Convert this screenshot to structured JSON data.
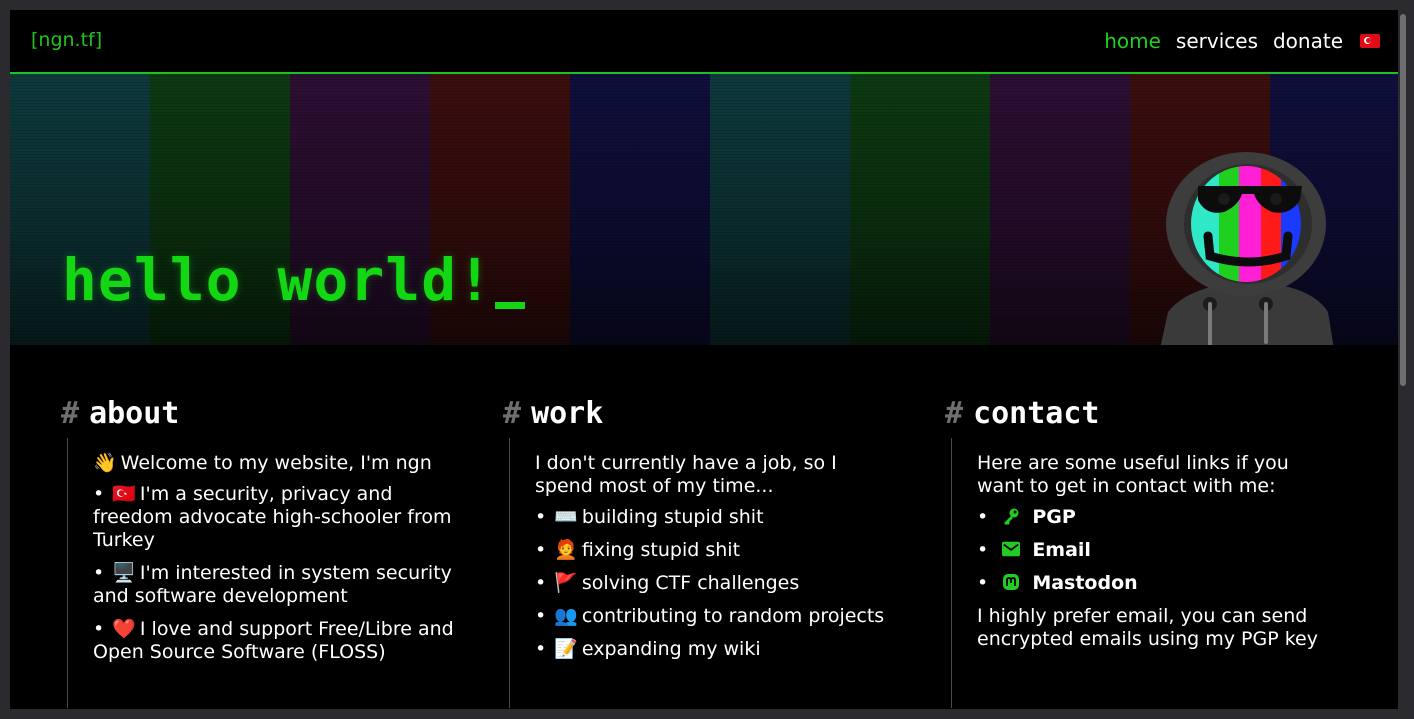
{
  "header": {
    "logo": "[ngn.tf]",
    "nav": [
      "home",
      "services",
      "donate"
    ],
    "language_flag": "flag-tr-icon"
  },
  "hero": {
    "title": "hello world!",
    "bar_colors": [
      "#0e3a3d",
      "#0d3a12",
      "#2d0f33",
      "#3d0e0e",
      "#0f0f3d",
      "#0e3a3d",
      "#0d3a12",
      "#2d0f33",
      "#3d0e0e",
      "#0f0f3d"
    ]
  },
  "about": {
    "heading": "about",
    "intro_emoji": "👋",
    "intro": "Welcome to my website, I'm ngn",
    "items": [
      {
        "emoji": "🇹🇷",
        "text": "I'm a security, privacy and freedom advocate high-schooler from Turkey"
      },
      {
        "emoji": "🖥️",
        "text": "I'm interested in system security and software development"
      },
      {
        "emoji": "❤️",
        "text": "I love and support Free/Libre and Open Source Software (FLOSS)"
      }
    ]
  },
  "work": {
    "heading": "work",
    "intro": "I don't currently have a job, so I spend most of my time...",
    "items": [
      {
        "emoji": "⌨️",
        "text": "building stupid shit"
      },
      {
        "emoji": "🧑‍🦰",
        "text": "fixing stupid shit"
      },
      {
        "emoji": "🚩",
        "text": "solving CTF challenges"
      },
      {
        "emoji": "👥",
        "text": "contributing to random projects"
      },
      {
        "emoji": "📝",
        "text": "expanding my wiki"
      }
    ]
  },
  "contact": {
    "heading": "contact",
    "intro": "Here are some useful links if you want to get in contact with me:",
    "links": [
      {
        "icon": "key-icon",
        "label": "PGP"
      },
      {
        "icon": "mail-icon",
        "label": "Email"
      },
      {
        "icon": "mastodon-icon",
        "label": "Mastodon"
      }
    ],
    "footer": "I highly prefer email, you can send encrypted emails using my PGP key"
  },
  "colors": {
    "accent": "#1fc31f",
    "background": "#000000",
    "text": "#ffffff"
  }
}
